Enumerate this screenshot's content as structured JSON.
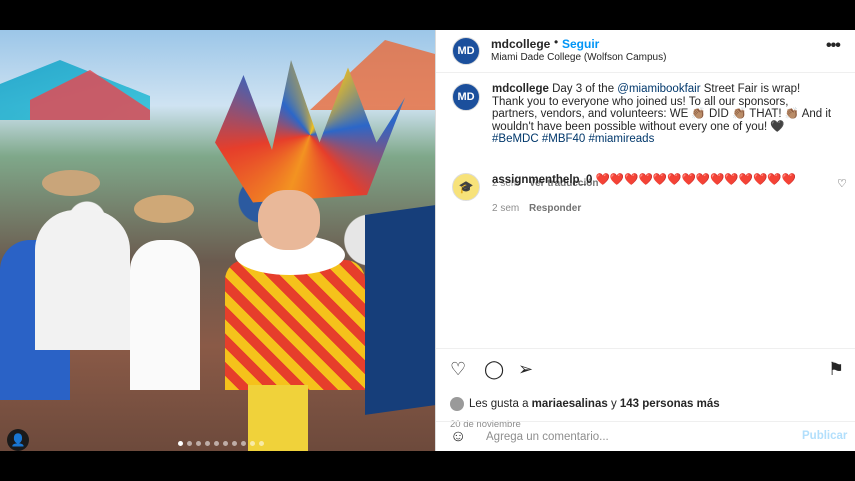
{
  "post": {
    "username": "mdcollege",
    "follow_label": "Seguir",
    "separator": "•",
    "location": "Miami Dade College (Wolfson Campus)",
    "avatar_text": "MD",
    "more": "•••"
  },
  "caption": {
    "username": "mdcollege",
    "part1": " Day 3 of the ",
    "mention": "@miamibookfair",
    "part2": " Street Fair is wrap! Thank you to everyone who joined us! To all our sponsors, partners, vendors, and volunteers: WE 👏🏽 DID 👏🏽 THAT! 👏🏽 And it wouldn't have been possible without every one of you! 🖤",
    "hashtags": "#BeMDC #MBF40 #miamireads",
    "time": "2 sem",
    "translate": "Ver traducción"
  },
  "comment": {
    "username": "assignmenthelp_0",
    "text": "❤️❤️❤️❤️❤️❤️❤️❤️❤️❤️❤️❤️❤️❤️",
    "time": "2 sem",
    "reply": "Responder",
    "avatar": "🎓"
  },
  "icons": {
    "like": "♡",
    "comment": "◯",
    "share": "➢",
    "save": "⚑",
    "emoji": "☺",
    "comment_like": "♡",
    "user": "👤"
  },
  "likes": {
    "prefix": "Les gusta a ",
    "user": "mariaesalinas",
    "middle": " y ",
    "count": "143 personas más"
  },
  "date": "20 de noviembre",
  "add_comment": {
    "placeholder": "Agrega un comentario...",
    "post_label": "Publicar"
  },
  "carousel": {
    "total": 10,
    "active": 0
  },
  "colors": {
    "accent": "#0095f6",
    "link": "#00376b",
    "brand": "#1b4f9c"
  }
}
